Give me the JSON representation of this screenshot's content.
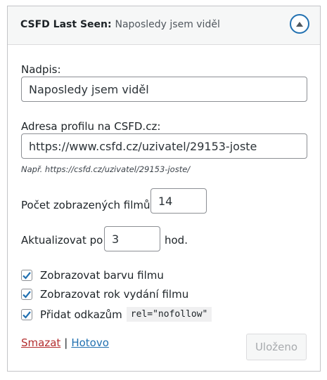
{
  "header": {
    "widget_name": "CSFD Last Seen",
    "separator": ":",
    "widget_title": "Naposledy jsem viděl",
    "toggle_icon": "chevron-up-icon"
  },
  "form": {
    "title_label": "Nadpis:",
    "title_value": "Naposledy jsem viděl",
    "profile_label": "Adresa profilu na CSFD.cz:",
    "profile_value": "https://www.csfd.cz/uzivatel/29153-joste",
    "profile_hint": "Např. https://csfd.cz/uzivatel/29153-joste/",
    "count_label": "Počet zobrazených filmů:",
    "count_value": "14",
    "update_label": "Aktualizovat po",
    "update_value": "3",
    "update_unit": "hod.",
    "checkboxes": [
      {
        "label": "Zobrazovat barvu filmu",
        "checked": true
      },
      {
        "label": "Zobrazovat rok vydání filmu",
        "checked": true
      },
      {
        "label": "Přidat odkazům",
        "checked": true,
        "code": "rel=\"nofollow\""
      }
    ]
  },
  "footer": {
    "delete_label": "Smazat",
    "separator": "|",
    "done_label": "Hotovo",
    "save_label": "Uloženo"
  },
  "colors": {
    "accent": "#2271b1",
    "delete": "#b32d2e",
    "border": "#c3c4c7"
  }
}
